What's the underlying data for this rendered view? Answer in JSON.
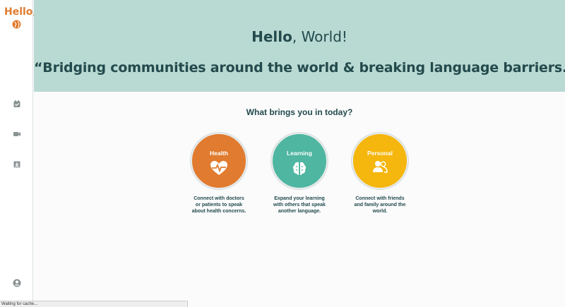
{
  "sidebar": {
    "brand": "Hello,",
    "items": [
      {
        "icon": "calendar-check-icon"
      },
      {
        "icon": "video-icon"
      },
      {
        "icon": "download-box-icon"
      },
      {
        "icon": "account-circle-icon"
      }
    ]
  },
  "hero": {
    "title_bold": "Hello",
    "title_rest": ", World!",
    "quote": "“Bridging communities around the world & breaking language barriers.”"
  },
  "main": {
    "question": "What brings you in today?",
    "cards": [
      {
        "label": "Health",
        "icon": "heartbeat-icon",
        "color": "#e07b2f",
        "desc": [
          "Connect with doctors",
          "or patients to speak",
          "about health concerns."
        ]
      },
      {
        "label": "Learning",
        "icon": "brain-icon",
        "color": "#4fb6a1",
        "desc": [
          "Expand your learning",
          "with others that speak",
          "another language."
        ]
      },
      {
        "label": "Personal",
        "icon": "people-icon",
        "color": "#f5b60d",
        "desc": [
          "Connect with friends",
          "and family around the",
          "world."
        ]
      }
    ]
  },
  "status_bar": {
    "text": "Waiting for cache..."
  },
  "colors": {
    "hero_bg": "#b9d9d3",
    "text_dark": "#234a4c",
    "brand_orange": "#e07b2f"
  }
}
